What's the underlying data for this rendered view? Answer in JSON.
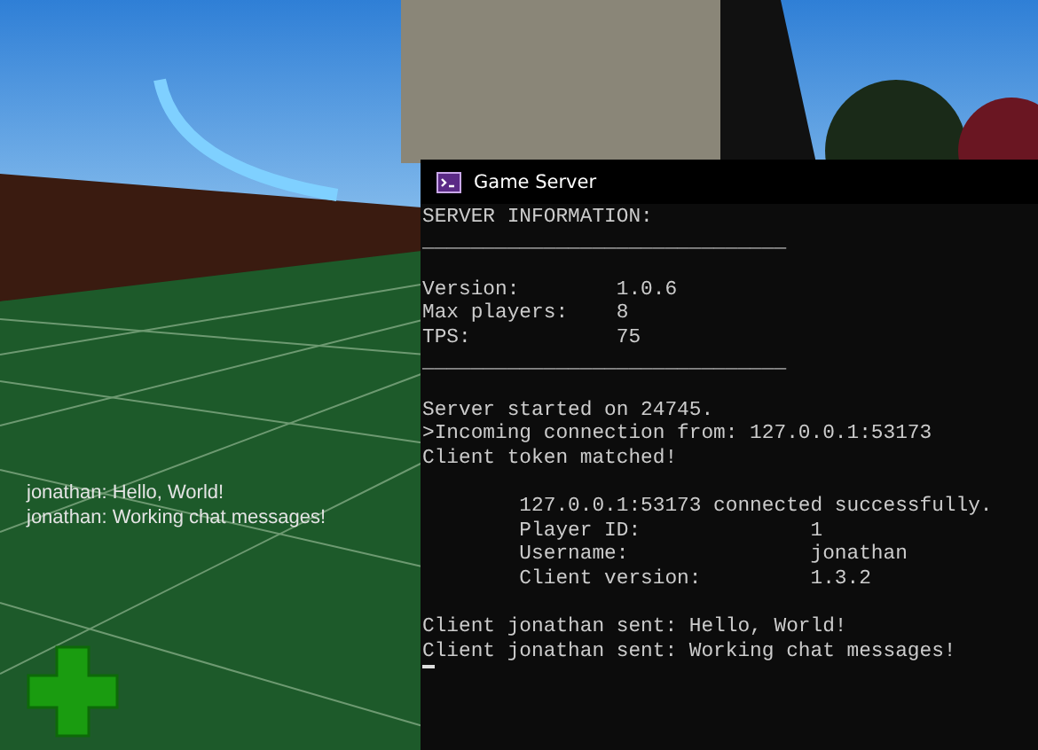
{
  "chat": {
    "messages": [
      "jonathan: Hello, World!",
      "jonathan: Working chat messages!"
    ]
  },
  "console": {
    "title": "Game Server",
    "lines": [
      {
        "kind": "text",
        "text": "SERVER INFORMATION:"
      },
      {
        "kind": "text",
        "text": "______________________________"
      },
      {
        "kind": "blank"
      },
      {
        "kind": "text",
        "text": "Version:        1.0.6"
      },
      {
        "kind": "text",
        "text": "Max players:    8"
      },
      {
        "kind": "text",
        "text": "TPS:            75"
      },
      {
        "kind": "text",
        "text": "______________________________"
      },
      {
        "kind": "blank"
      },
      {
        "kind": "text",
        "text": "Server started on 24745."
      },
      {
        "kind": "text",
        "text": ">Incoming connection from: 127.0.0.1:53173"
      },
      {
        "kind": "text",
        "text": "Client token matched!"
      },
      {
        "kind": "blank"
      },
      {
        "kind": "text",
        "text": "        127.0.0.1:53173 connected successfully."
      },
      {
        "kind": "text",
        "text": "        Player ID:              1"
      },
      {
        "kind": "text",
        "text": "        Username:               jonathan"
      },
      {
        "kind": "text",
        "text": "        Client version:         1.3.2"
      },
      {
        "kind": "blank"
      },
      {
        "kind": "text",
        "text": "Client jonathan sent: Hello, World!"
      },
      {
        "kind": "text",
        "text": "Client jonathan sent: Working chat messages!"
      },
      {
        "kind": "cursor"
      }
    ]
  }
}
